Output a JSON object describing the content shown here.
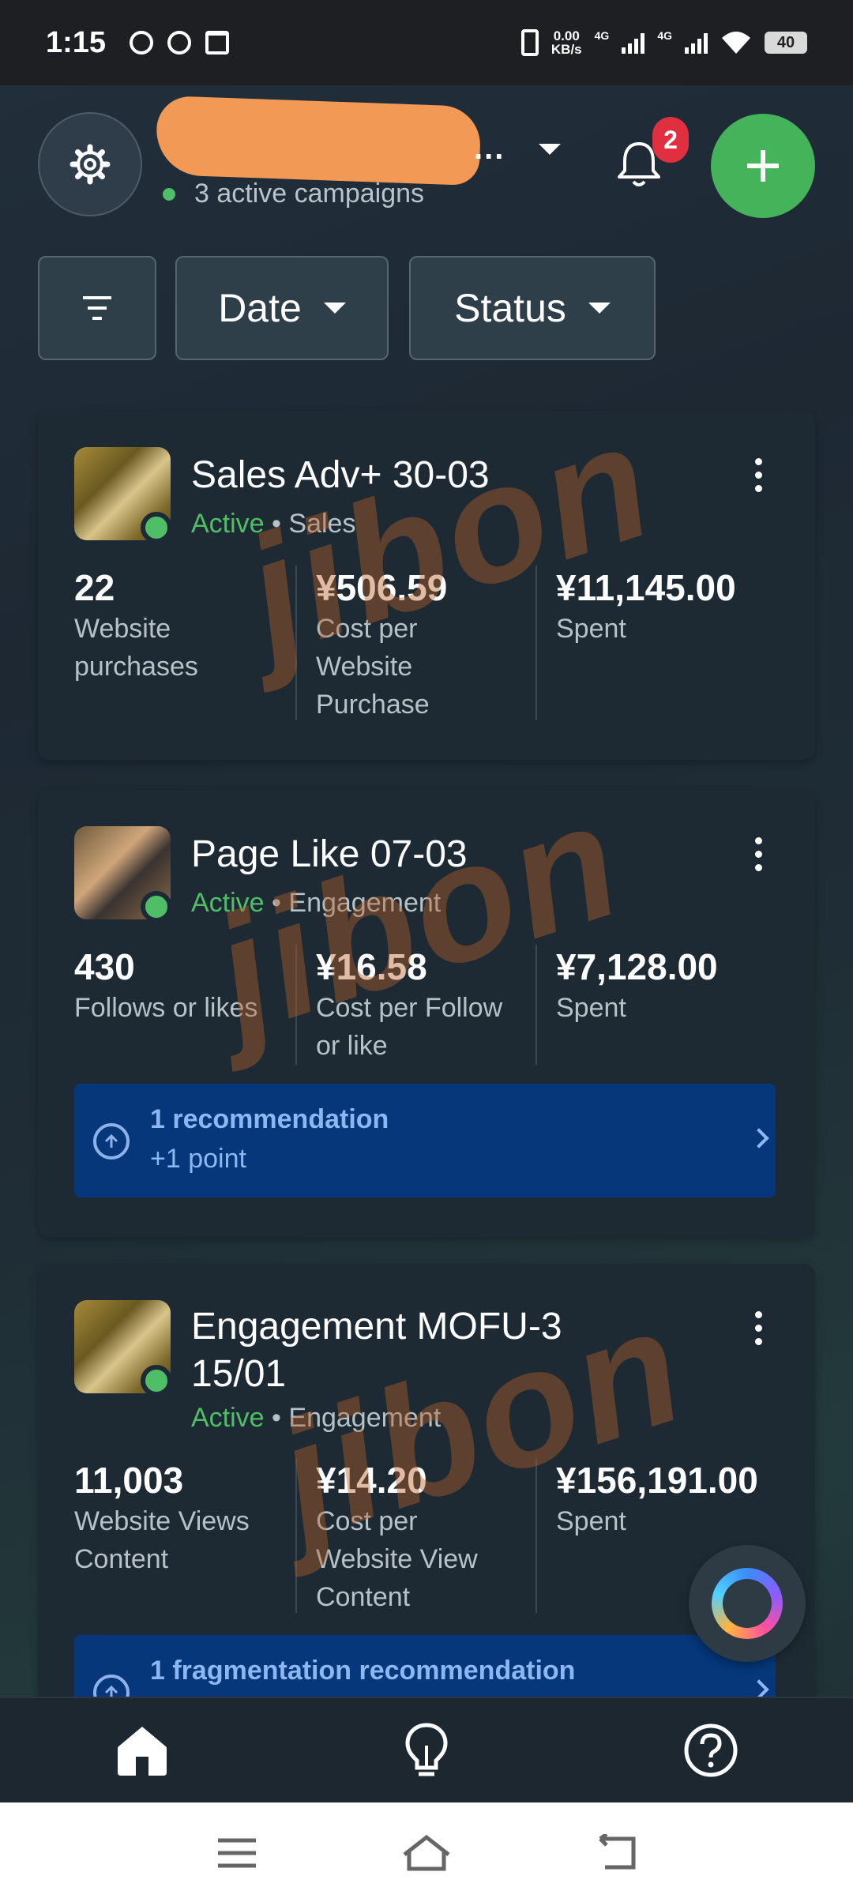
{
  "status_bar": {
    "time": "1:15",
    "net_speed_value": "0.00",
    "net_speed_unit": "KB/s",
    "sig1_label": "4G",
    "sig2_label": "4G",
    "battery": "40"
  },
  "header": {
    "account_name": "",
    "account_suffix": "...",
    "active_campaigns": "3 active campaigns",
    "notification_count": "2"
  },
  "filters": {
    "date_label": "Date",
    "status_label": "Status"
  },
  "campaigns": [
    {
      "title": "Sales Adv+ 30-03",
      "status": "Active",
      "objective": "Sales",
      "metrics": [
        {
          "value": "22",
          "label": "Website purchases"
        },
        {
          "value": "¥506.59",
          "label": "Cost per Website Purchase"
        },
        {
          "value": "¥11,145.00",
          "label": "Spent"
        }
      ]
    },
    {
      "title": "Page Like 07-03",
      "status": "Active",
      "objective": "Engagement",
      "metrics": [
        {
          "value": "430",
          "label": "Follows or likes"
        },
        {
          "value": "¥16.58",
          "label": "Cost per Follow or like"
        },
        {
          "value": "¥7,128.00",
          "label": "Spent"
        }
      ],
      "recommendation": {
        "title": "1 recommendation",
        "subtitle": "+1 point"
      }
    },
    {
      "title": "Engagement MOFU-3 15/01",
      "status": "Active",
      "objective": "Engagement",
      "metrics": [
        {
          "value": "11,003",
          "label": "Website Views Content"
        },
        {
          "value": "¥14.20",
          "label": "Cost per Website View Content"
        },
        {
          "value": "¥156,191.00",
          "label": "Spent"
        }
      ],
      "recommendation": {
        "title": "1 fragmentation recommendation"
      }
    }
  ],
  "watermark": "jibon",
  "bottom_nav": {
    "items": [
      {
        "icon": "home-icon",
        "active": true
      },
      {
        "icon": "lightbulb-icon",
        "active": false
      },
      {
        "icon": "help-icon",
        "active": false
      }
    ]
  },
  "system_nav": [
    "menu-icon",
    "home-outline-icon",
    "back-icon"
  ]
}
